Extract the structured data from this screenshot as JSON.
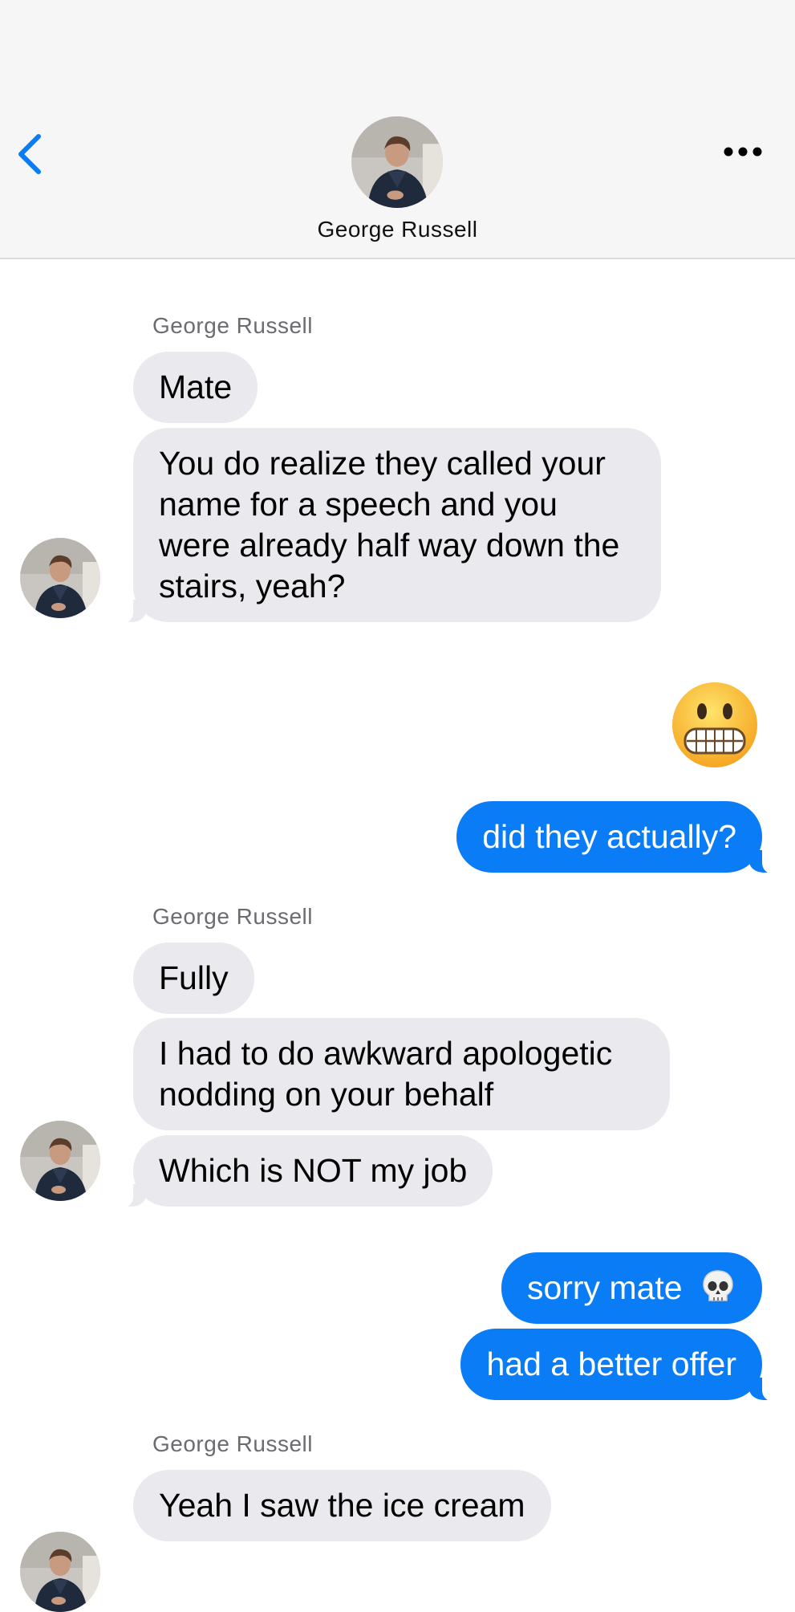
{
  "header": {
    "contact_name": "George Russell",
    "back_icon": "chevron-left-icon",
    "more_icon": "ellipsis-icon",
    "accent_color": "#0a7cf5"
  },
  "messages": {
    "group1": {
      "sender": "George Russell",
      "bubbles": [
        "Mate",
        "You do realize they called your name for a speech and you were already half way down the stairs, yeah?"
      ]
    },
    "out1": {
      "emoji": "grimacing-face-emoji",
      "text": "did they actually?"
    },
    "group2": {
      "sender": "George Russell",
      "bubbles": [
        "Fully",
        "I had to do awkward apologetic nodding on your behalf",
        "Which is NOT my job"
      ]
    },
    "out2": {
      "bubbles": [
        "sorry mate",
        "had a better offer"
      ],
      "emoji": "skull-emoji"
    },
    "group3": {
      "sender": "George Russell",
      "bubbles": [
        "Yeah I saw the ice cream"
      ]
    }
  },
  "colors": {
    "incoming_bubble": "#e9e9ee",
    "outgoing_bubble": "#0a7cf5"
  }
}
